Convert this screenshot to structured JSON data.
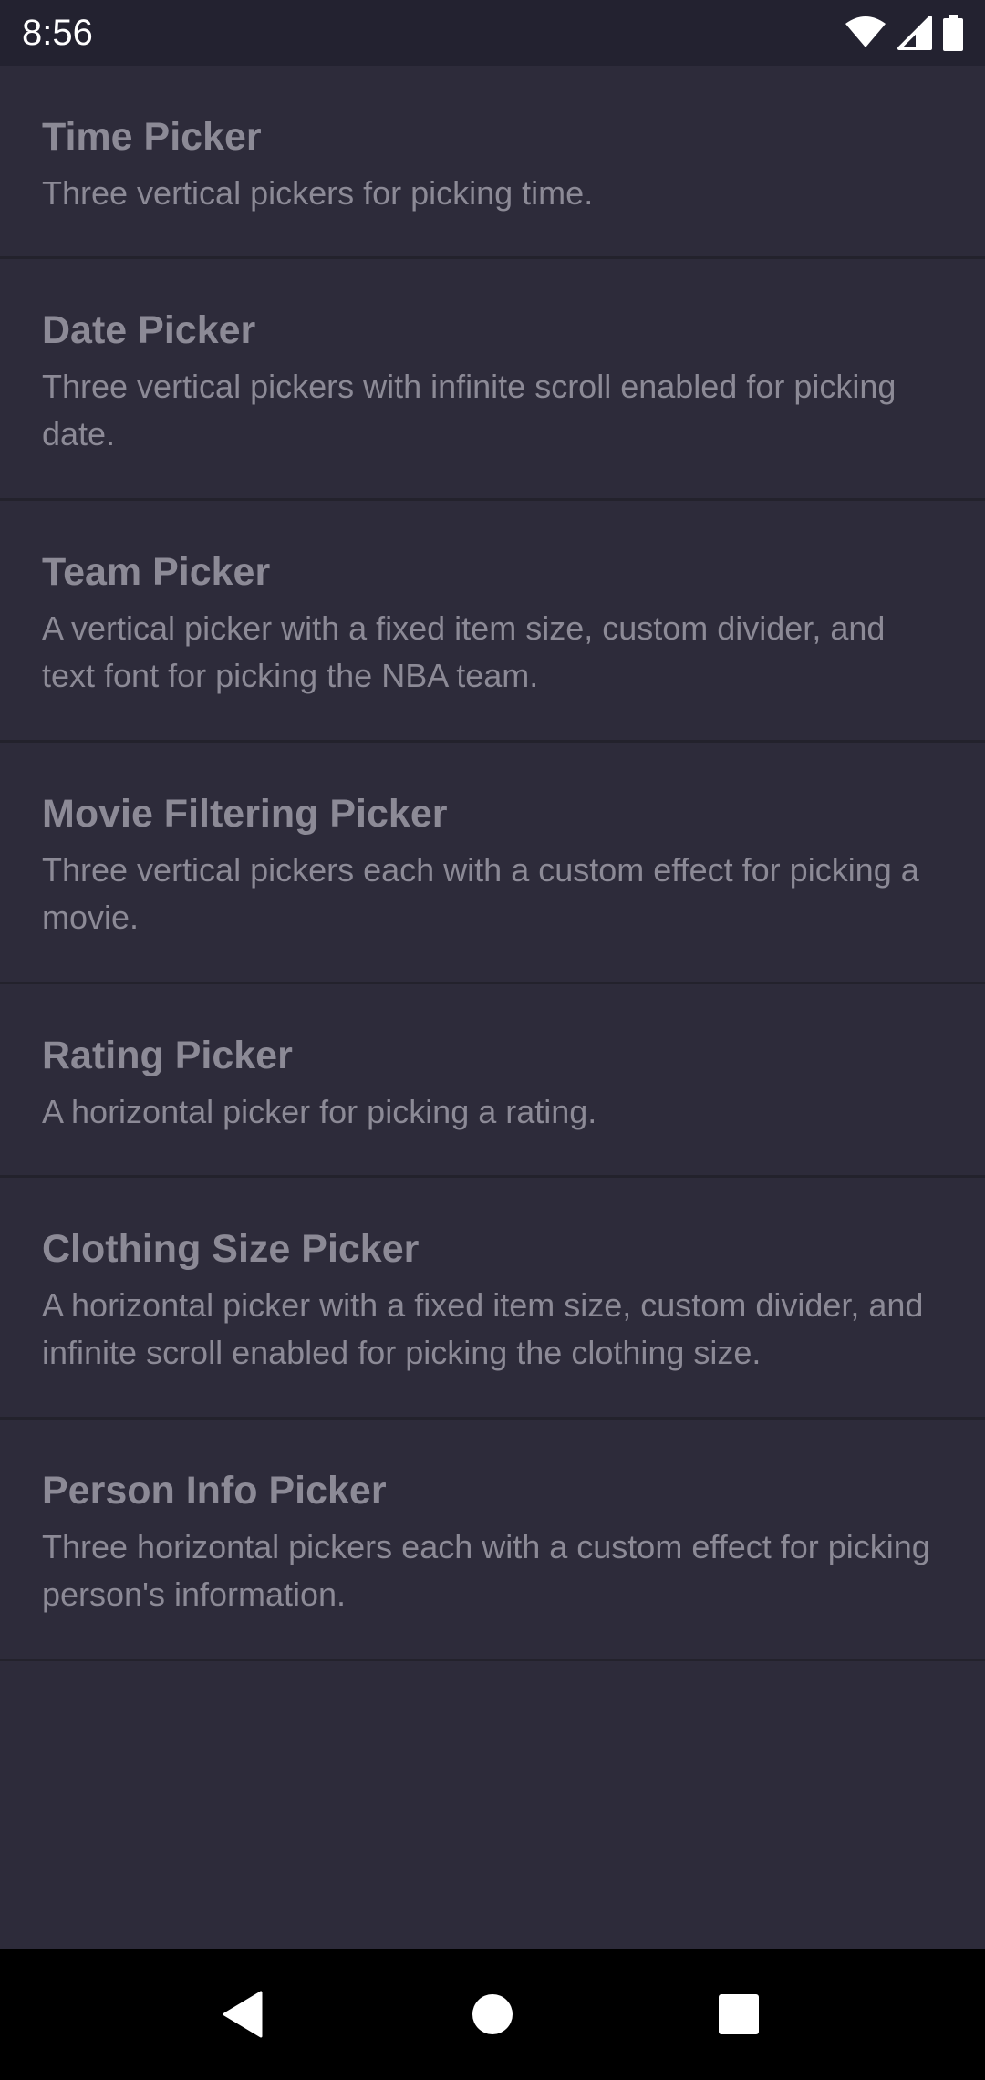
{
  "status_bar": {
    "time": "8:56",
    "icons": [
      "wifi-icon",
      "cellular-signal-icon",
      "battery-icon"
    ]
  },
  "pickers": [
    {
      "title": "Time Picker",
      "description": "Three vertical pickers for picking time."
    },
    {
      "title": "Date Picker",
      "description": "Three vertical pickers with infinite scroll enabled for picking date."
    },
    {
      "title": "Team Picker",
      "description": "A vertical picker with a fixed item size, custom divider, and text font for picking the NBA team."
    },
    {
      "title": "Movie Filtering Picker",
      "description": "Three vertical pickers each with a custom effect for picking a movie."
    },
    {
      "title": "Rating Picker",
      "description": "A horizontal picker for picking a rating."
    },
    {
      "title": "Clothing Size Picker",
      "description": "A horizontal picker with a fixed item size, custom divider, and infinite scroll enabled for picking the clothing size."
    },
    {
      "title": "Person Info Picker",
      "description": "Three horizontal pickers each with a custom effect for picking person's information."
    }
  ],
  "nav_bar": {
    "buttons": [
      "back-triangle-icon",
      "home-circle-icon",
      "recents-square-icon"
    ]
  },
  "colors": {
    "background": "#2d2b3a",
    "status_bar": "#232230",
    "divider": "#23222c",
    "text": "#8c8a96",
    "nav_bar": "#000000"
  }
}
